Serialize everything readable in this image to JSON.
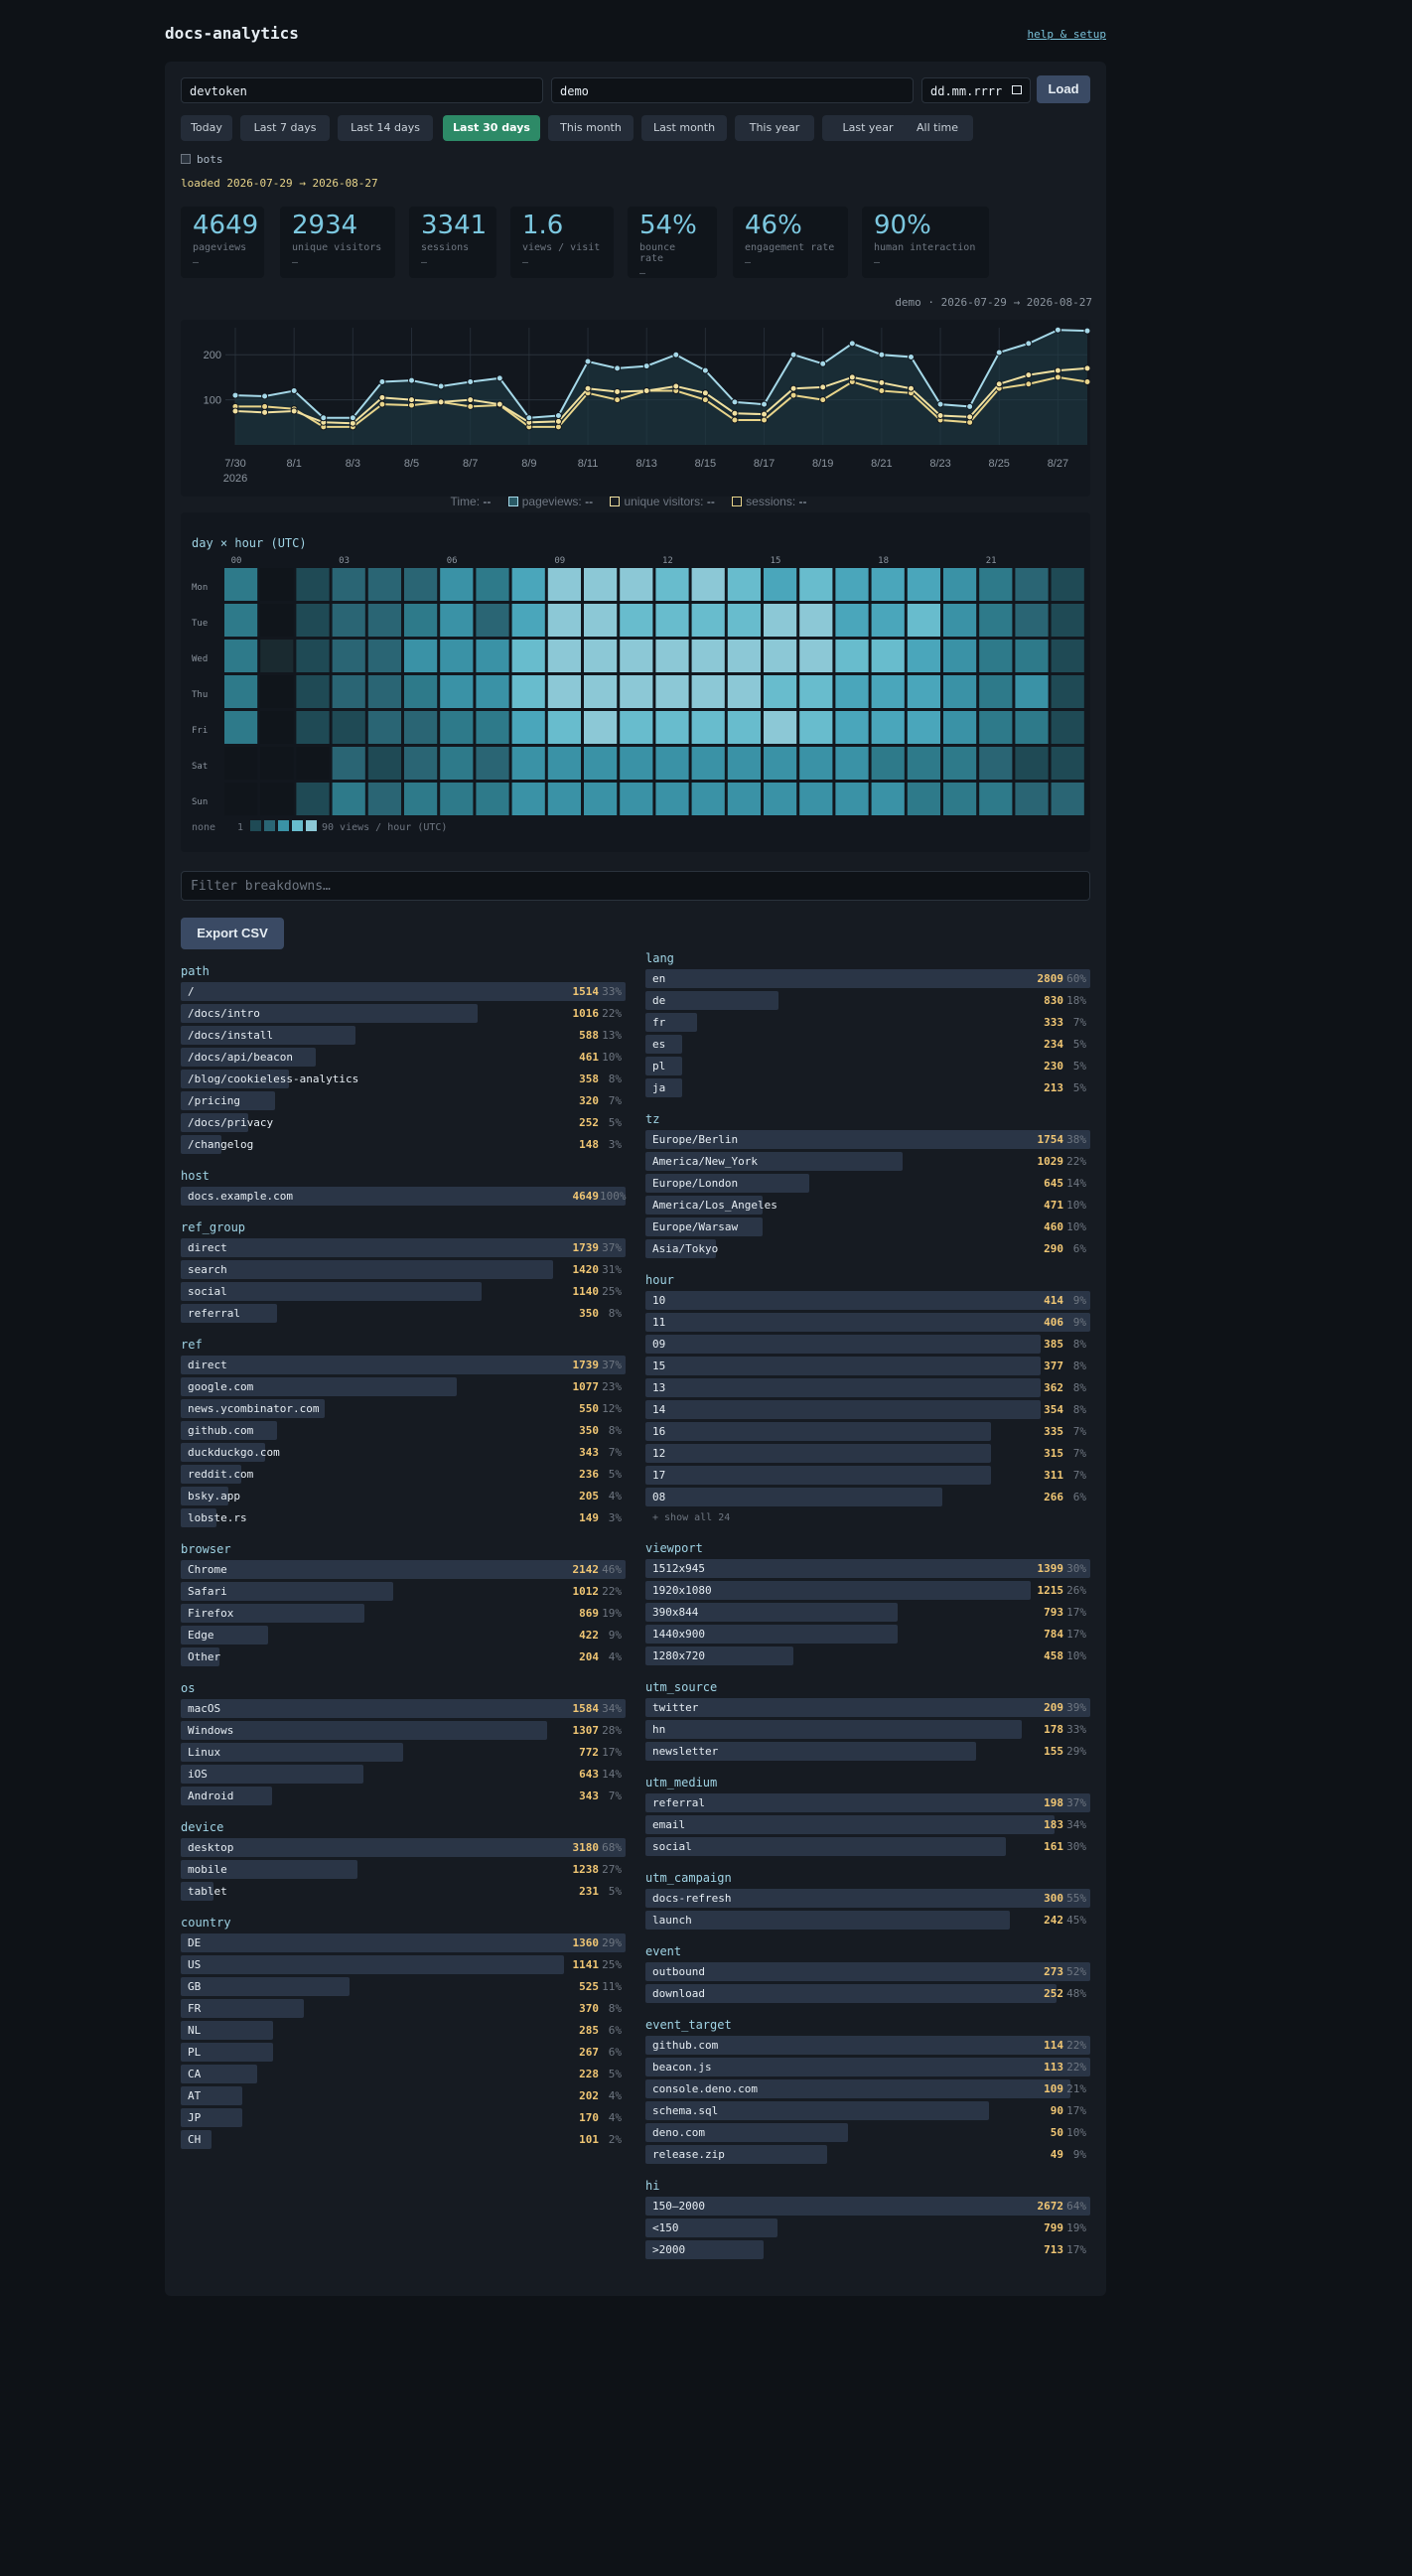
{
  "app": {
    "title": "docs-analytics",
    "help": "help & setup"
  },
  "inputs": {
    "token": "devtoken",
    "site": "demo",
    "date": "dd.mm.rrrr",
    "load": "Load"
  },
  "ranges": [
    {
      "label": "Today"
    },
    {
      "label": "Last 7 days"
    },
    {
      "label": "Last 14 days"
    },
    {
      "label": "Last 30 days",
      "active": true
    },
    {
      "label": "This month"
    },
    {
      "label": "Last month"
    },
    {
      "label": "This year"
    },
    {
      "label": "Last year"
    },
    {
      "label": "All time"
    }
  ],
  "bots_label": "bots",
  "loaded": "loaded 2026-07-29 → 2026-08-27",
  "kpis": [
    {
      "value": "4649",
      "label": "pageviews",
      "delta": "–"
    },
    {
      "value": "2934",
      "label": "unique visitors",
      "delta": "–"
    },
    {
      "value": "3341",
      "label": "sessions",
      "delta": "–"
    },
    {
      "value": "1.6",
      "label": "views / visit",
      "delta": "–"
    },
    {
      "value": "54%",
      "label": "bounce rate",
      "delta": "–"
    },
    {
      "value": "46%",
      "label": "engagement rate",
      "delta": "–"
    },
    {
      "value": "90%",
      "label": "human interaction",
      "delta": "–"
    }
  ],
  "chart_label": "demo · 2026-07-29 → 2026-08-27",
  "chart_data": {
    "type": "line",
    "x": [
      "7/30",
      "7/31",
      "8/1",
      "8/2",
      "8/3",
      "8/4",
      "8/5",
      "8/6",
      "8/7",
      "8/8",
      "8/9",
      "8/10",
      "8/11",
      "8/12",
      "8/13",
      "8/14",
      "8/15",
      "8/16",
      "8/17",
      "8/18",
      "8/19",
      "8/20",
      "8/21",
      "8/22",
      "8/23",
      "8/24",
      "8/25",
      "8/26",
      "8/27"
    ],
    "xticks": [
      "7/30",
      "8/1",
      "8/3",
      "8/5",
      "8/7",
      "8/9",
      "8/11",
      "8/13",
      "8/15",
      "8/17",
      "8/19",
      "8/21",
      "8/23",
      "8/25",
      "8/27"
    ],
    "year": "2026",
    "yticks": [
      100,
      200
    ],
    "ylim": [
      0,
      260
    ],
    "series": [
      {
        "name": "pageviews",
        "color": "#a5d8e8",
        "values": [
          110,
          108,
          120,
          60,
          60,
          140,
          143,
          130,
          140,
          148,
          60,
          65,
          185,
          170,
          175,
          200,
          165,
          95,
          90,
          200,
          180,
          225,
          200,
          195,
          90,
          85,
          205,
          225,
          255,
          253
        ]
      },
      {
        "name": "unique visitors",
        "color": "#f0e0a0",
        "values": [
          75,
          72,
          75,
          50,
          48,
          105,
          100,
          95,
          100,
          90,
          50,
          52,
          125,
          118,
          120,
          130,
          115,
          70,
          68,
          125,
          128,
          150,
          138,
          125,
          65,
          62,
          135,
          155,
          165,
          170
        ]
      },
      {
        "name": "sessions",
        "color": "#e8d48a",
        "values": [
          85,
          85,
          80,
          40,
          40,
          90,
          88,
          95,
          85,
          88,
          40,
          40,
          115,
          100,
          120,
          120,
          100,
          55,
          55,
          110,
          100,
          140,
          120,
          115,
          55,
          50,
          125,
          135,
          150,
          140
        ]
      }
    ],
    "legend_prefix": "Time:",
    "legend_value": "--"
  },
  "heatmap": {
    "title": "day × hour (UTC)",
    "hours": [
      "00",
      "03",
      "06",
      "09",
      "12",
      "15",
      "18",
      "21"
    ],
    "days": [
      "Mon",
      "Tue",
      "Wed",
      "Thu",
      "Fri",
      "Sat",
      "Sun"
    ],
    "legend_min": "none",
    "legend_one": "1",
    "legend_max": "90 views / hour (UTC)",
    "grid": [
      [
        20,
        0,
        10,
        15,
        15,
        15,
        30,
        25,
        45,
        70,
        70,
        70,
        60,
        70,
        60,
        45,
        50,
        40,
        45,
        45,
        35,
        25,
        15,
        10
      ],
      [
        20,
        0,
        10,
        15,
        15,
        25,
        35,
        15,
        45,
        70,
        75,
        60,
        60,
        60,
        60,
        70,
        65,
        45,
        45,
        55,
        35,
        20,
        15,
        10
      ],
      [
        20,
        5,
        10,
        15,
        15,
        30,
        35,
        35,
        55,
        75,
        75,
        75,
        70,
        70,
        70,
        75,
        65,
        60,
        55,
        45,
        35,
        25,
        20,
        10
      ],
      [
        20,
        0,
        10,
        15,
        15,
        20,
        35,
        35,
        60,
        70,
        70,
        70,
        70,
        70,
        65,
        60,
        55,
        45,
        45,
        40,
        35,
        20,
        35,
        10
      ],
      [
        20,
        0,
        10,
        10,
        15,
        15,
        25,
        20,
        45,
        50,
        70,
        60,
        60,
        55,
        55,
        65,
        50,
        40,
        45,
        40,
        35,
        25,
        20,
        10
      ],
      [
        0,
        0,
        0,
        15,
        10,
        15,
        20,
        15,
        35,
        35,
        35,
        35,
        35,
        35,
        35,
        35,
        35,
        35,
        25,
        25,
        20,
        15,
        10,
        10
      ],
      [
        0,
        0,
        10,
        20,
        15,
        20,
        20,
        20,
        35,
        35,
        35,
        35,
        35,
        35,
        35,
        35,
        30,
        30,
        30,
        25,
        25,
        20,
        15,
        15
      ]
    ]
  },
  "filter_placeholder": "Filter breakdowns…",
  "export": "Export CSV",
  "left": [
    {
      "name": "path",
      "rows": [
        [
          "/",
          "1514",
          "33%"
        ],
        [
          "/docs/intro",
          "1016",
          "22%"
        ],
        [
          "/docs/install",
          "588",
          "13%"
        ],
        [
          "/docs/api/beacon",
          "461",
          "10%"
        ],
        [
          "/blog/cookieless-analytics",
          "358",
          "8%"
        ],
        [
          "/pricing",
          "320",
          "7%"
        ],
        [
          "/docs/privacy",
          "252",
          "5%"
        ],
        [
          "/changelog",
          "148",
          "3%"
        ]
      ]
    },
    {
      "name": "host",
      "rows": [
        [
          "docs.example.com",
          "4649",
          "100%"
        ]
      ]
    },
    {
      "name": "ref_group",
      "rows": [
        [
          "direct",
          "1739",
          "37%"
        ],
        [
          "search",
          "1420",
          "31%"
        ],
        [
          "social",
          "1140",
          "25%"
        ],
        [
          "referral",
          "350",
          "8%"
        ]
      ]
    },
    {
      "name": "ref",
      "rows": [
        [
          "direct",
          "1739",
          "37%"
        ],
        [
          "google.com",
          "1077",
          "23%"
        ],
        [
          "news.ycombinator.com",
          "550",
          "12%"
        ],
        [
          "github.com",
          "350",
          "8%"
        ],
        [
          "duckduckgo.com",
          "343",
          "7%"
        ],
        [
          "reddit.com",
          "236",
          "5%"
        ],
        [
          "bsky.app",
          "205",
          "4%"
        ],
        [
          "lobste.rs",
          "149",
          "3%"
        ]
      ]
    },
    {
      "name": "browser",
      "rows": [
        [
          "Chrome",
          "2142",
          "46%"
        ],
        [
          "Safari",
          "1012",
          "22%"
        ],
        [
          "Firefox",
          "869",
          "19%"
        ],
        [
          "Edge",
          "422",
          "9%"
        ],
        [
          "Other",
          "204",
          "4%"
        ]
      ]
    },
    {
      "name": "os",
      "rows": [
        [
          "macOS",
          "1584",
          "34%"
        ],
        [
          "Windows",
          "1307",
          "28%"
        ],
        [
          "Linux",
          "772",
          "17%"
        ],
        [
          "iOS",
          "643",
          "14%"
        ],
        [
          "Android",
          "343",
          "7%"
        ]
      ]
    },
    {
      "name": "device",
      "rows": [
        [
          "desktop",
          "3180",
          "68%"
        ],
        [
          "mobile",
          "1238",
          "27%"
        ],
        [
          "tablet",
          "231",
          "5%"
        ]
      ]
    },
    {
      "name": "country",
      "rows": [
        [
          "DE",
          "1360",
          "29%"
        ],
        [
          "US",
          "1141",
          "25%"
        ],
        [
          "GB",
          "525",
          "11%"
        ],
        [
          "FR",
          "370",
          "8%"
        ],
        [
          "NL",
          "285",
          "6%"
        ],
        [
          "PL",
          "267",
          "6%"
        ],
        [
          "CA",
          "228",
          "5%"
        ],
        [
          "AT",
          "202",
          "4%"
        ],
        [
          "JP",
          "170",
          "4%"
        ],
        [
          "CH",
          "101",
          "2%"
        ]
      ]
    }
  ],
  "right": [
    {
      "name": "lang",
      "rows": [
        [
          "en",
          "2809",
          "60%"
        ],
        [
          "de",
          "830",
          "18%"
        ],
        [
          "fr",
          "333",
          "7%"
        ],
        [
          "es",
          "234",
          "5%"
        ],
        [
          "pl",
          "230",
          "5%"
        ],
        [
          "ja",
          "213",
          "5%"
        ]
      ]
    },
    {
      "name": "tz",
      "rows": [
        [
          "Europe/Berlin",
          "1754",
          "38%"
        ],
        [
          "America/New_York",
          "1029",
          "22%"
        ],
        [
          "Europe/London",
          "645",
          "14%"
        ],
        [
          "America/Los_Angeles",
          "471",
          "10%"
        ],
        [
          "Europe/Warsaw",
          "460",
          "10%"
        ],
        [
          "Asia/Tokyo",
          "290",
          "6%"
        ]
      ]
    },
    {
      "name": "hour",
      "rows": [
        [
          "10",
          "414",
          "9%"
        ],
        [
          "11",
          "406",
          "9%"
        ],
        [
          "09",
          "385",
          "8%"
        ],
        [
          "15",
          "377",
          "8%"
        ],
        [
          "13",
          "362",
          "8%"
        ],
        [
          "14",
          "354",
          "8%"
        ],
        [
          "16",
          "335",
          "7%"
        ],
        [
          "12",
          "315",
          "7%"
        ],
        [
          "17",
          "311",
          "7%"
        ],
        [
          "08",
          "266",
          "6%"
        ]
      ],
      "more": "+ show all 24"
    },
    {
      "name": "viewport",
      "rows": [
        [
          "1512x945",
          "1399",
          "30%"
        ],
        [
          "1920x1080",
          "1215",
          "26%"
        ],
        [
          "390x844",
          "793",
          "17%"
        ],
        [
          "1440x900",
          "784",
          "17%"
        ],
        [
          "1280x720",
          "458",
          "10%"
        ]
      ]
    },
    {
      "name": "utm_source",
      "rows": [
        [
          "twitter",
          "209",
          "39%"
        ],
        [
          "hn",
          "178",
          "33%"
        ],
        [
          "newsletter",
          "155",
          "29%"
        ]
      ]
    },
    {
      "name": "utm_medium",
      "rows": [
        [
          "referral",
          "198",
          "37%"
        ],
        [
          "email",
          "183",
          "34%"
        ],
        [
          "social",
          "161",
          "30%"
        ]
      ]
    },
    {
      "name": "utm_campaign",
      "rows": [
        [
          "docs-refresh",
          "300",
          "55%"
        ],
        [
          "launch",
          "242",
          "45%"
        ]
      ]
    },
    {
      "name": "event",
      "rows": [
        [
          "outbound",
          "273",
          "52%"
        ],
        [
          "download",
          "252",
          "48%"
        ]
      ]
    },
    {
      "name": "event_target",
      "rows": [
        [
          "github.com",
          "114",
          "22%"
        ],
        [
          "beacon.js",
          "113",
          "22%"
        ],
        [
          "console.deno.com",
          "109",
          "21%"
        ],
        [
          "schema.sql",
          "90",
          "17%"
        ],
        [
          "deno.com",
          "50",
          "10%"
        ],
        [
          "release.zip",
          "49",
          "9%"
        ]
      ]
    },
    {
      "name": "hi",
      "rows": [
        [
          "150–2000",
          "2672",
          "64%"
        ],
        [
          "<150",
          "799",
          "19%"
        ],
        [
          ">2000",
          "713",
          "17%"
        ]
      ]
    }
  ]
}
